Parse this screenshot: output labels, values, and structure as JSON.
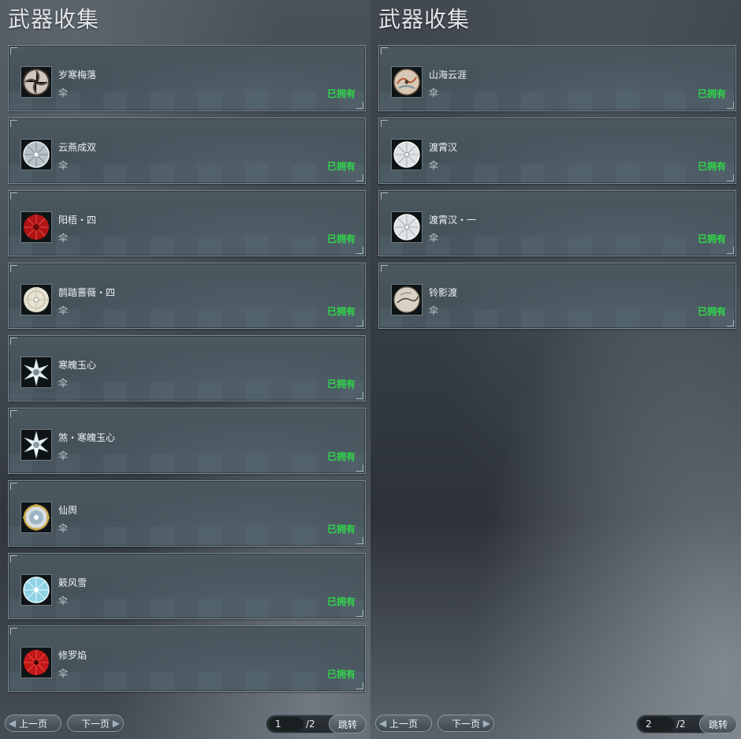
{
  "panels": [
    {
      "title": "武器收集",
      "items": [
        {
          "name": "岁寒梅落",
          "type": "伞",
          "status": "已拥有",
          "icon": "umbrella-icon-plum"
        },
        {
          "name": "云燕成双",
          "type": "伞",
          "status": "已拥有",
          "icon": "umbrella-icon-silver"
        },
        {
          "name": "阳梧・四",
          "type": "伞",
          "status": "已拥有",
          "icon": "umbrella-icon-red"
        },
        {
          "name": "鹊踏蔷薇・四",
          "type": "伞",
          "status": "已拥有",
          "icon": "umbrella-icon-pale"
        },
        {
          "name": "寒魄玉心",
          "type": "伞",
          "status": "已拥有",
          "icon": "umbrella-icon-snowflake"
        },
        {
          "name": "煞・寒魄玉心",
          "type": "伞",
          "status": "已拥有",
          "icon": "umbrella-icon-snowflake"
        },
        {
          "name": "仙舆",
          "type": "伞",
          "status": "已拥有",
          "icon": "umbrella-icon-gold"
        },
        {
          "name": "簌风雪",
          "type": "伞",
          "status": "已拥有",
          "icon": "umbrella-icon-ice"
        },
        {
          "name": "修罗焰",
          "type": "伞",
          "status": "已拥有",
          "icon": "umbrella-icon-crimson"
        }
      ],
      "pager": {
        "prev_label": "上一页",
        "next_label": "下一页",
        "current_page": "1",
        "total_label": "/2",
        "jump_label": "跳转"
      }
    },
    {
      "title": "武器收集",
      "items": [
        {
          "name": "山海云涯",
          "type": "伞",
          "status": "已拥有",
          "icon": "umbrella-icon-painted"
        },
        {
          "name": "渡霄汉",
          "type": "伞",
          "status": "已拥有",
          "icon": "umbrella-icon-white"
        },
        {
          "name": "渡霄汉・一",
          "type": "伞",
          "status": "已拥有",
          "icon": "umbrella-icon-white"
        },
        {
          "name": "铃影渡",
          "type": "伞",
          "status": "已拥有",
          "icon": "umbrella-icon-ink"
        }
      ],
      "pager": {
        "prev_label": "上一页",
        "next_label": "下一页",
        "current_page": "2",
        "total_label": "/2",
        "jump_label": "跳转"
      }
    }
  ],
  "colors": {
    "owned_status": "#2fd64a",
    "card_border": "#7e8a93",
    "title_text": "#dfe4e8"
  }
}
